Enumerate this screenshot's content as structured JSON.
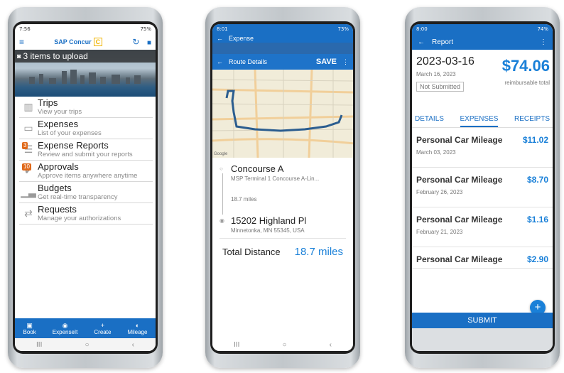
{
  "phone1": {
    "status_time": "7:56",
    "status_right": "75%",
    "app_title": "SAP Concur",
    "brand_mark": "C",
    "upload_banner": "3 items to upload",
    "menu": [
      {
        "title": "Trips",
        "sub": "View your trips",
        "icon": "briefcase-icon",
        "badge": ""
      },
      {
        "title": "Expenses",
        "sub": "List of your expenses",
        "icon": "wallet-icon",
        "badge": ""
      },
      {
        "title": "Expense Reports",
        "sub": "Review and submit your reports",
        "icon": "report-icon",
        "badge": "3"
      },
      {
        "title": "Approvals",
        "sub": "Approve items anywhere anytime",
        "icon": "checkmark-icon",
        "badge": "10"
      },
      {
        "title": "Budgets",
        "sub": "Get real-time transparency",
        "icon": "bar-chart-icon",
        "badge": ""
      },
      {
        "title": "Requests",
        "sub": "Manage your authorizations",
        "icon": "arrows-icon",
        "badge": ""
      }
    ],
    "bottom_nav": [
      {
        "label": "Book",
        "icon": "▣"
      },
      {
        "label": "ExpenseIt",
        "icon": "◉"
      },
      {
        "label": "Create",
        "icon": "+"
      },
      {
        "label": "Mileage",
        "icon": "◐"
      }
    ]
  },
  "phone2": {
    "status_time": "8:01",
    "status_right": "73%",
    "expense_title": "Expense",
    "route_title": "Route Details",
    "save_label": "SAVE",
    "map_credit": "Google",
    "start_name": "Concourse A",
    "start_addr": "MSP Terminal 1 Concourse A-Lin...",
    "distance_mid": "18.7 miles",
    "end_name": "15202 Highland Pl",
    "end_addr": "Minnetonka, MN 55345, USA",
    "total_label": "Total Distance",
    "total_value": "18.7 miles"
  },
  "phone3": {
    "status_time": "8:00",
    "status_right": "74%",
    "title": "Report",
    "date": "2023-03-16",
    "date_long": "March 16, 2023",
    "status": "Not Submitted",
    "amount": "$74.06",
    "amount_caption": "reimbursable total",
    "tabs": [
      "DETAILS",
      "EXPENSES",
      "RECEIPTS"
    ],
    "expenses": [
      {
        "name": "Personal Car Mileage",
        "amount": "$11.02",
        "date": "March 03, 2023"
      },
      {
        "name": "Personal Car Mileage",
        "amount": "$8.70",
        "date": "February 26, 2023"
      },
      {
        "name": "Personal Car Mileage",
        "amount": "$1.16",
        "date": "February 21, 2023"
      },
      {
        "name": "Personal Car Mileage",
        "amount": "$2.90",
        "date": ""
      }
    ],
    "submit_label": "SUBMIT"
  },
  "colors": {
    "primary": "#1a6fc4",
    "accent_amount": "#1a80d8",
    "badge": "#e0691a",
    "brand_yellow": "#f0b400"
  }
}
